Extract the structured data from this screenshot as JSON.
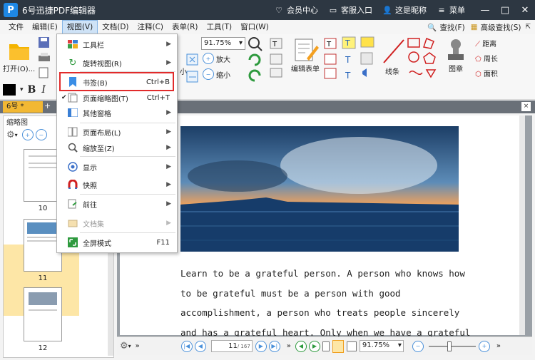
{
  "app": {
    "title": "6号迅捷PDF编辑器",
    "logo_letter": "P"
  },
  "titlebar": {
    "links": [
      {
        "icon": "heart-icon",
        "label": "会员中心"
      },
      {
        "icon": "chat-icon",
        "label": "客服入口"
      },
      {
        "icon": "user-icon",
        "label": "这是昵称"
      },
      {
        "icon": "hamburger-icon",
        "label": "菜单"
      }
    ],
    "win_min": "—",
    "win_max": "□",
    "win_close": "✕"
  },
  "menubar": {
    "items": [
      "文件",
      "编辑(E)",
      "视图(V)",
      "文档(D)",
      "注释(C)",
      "表单(R)",
      "工具(T)",
      "窗口(W)"
    ],
    "active_index": 2,
    "find_label": "查找(F)",
    "adv_find_label": "高级查找(S)"
  },
  "toolbar": {
    "open_label": "打开(O)...",
    "zoom_value": "91.75%",
    "zoom_in": "放大",
    "zoom_out": "缩小",
    "edit_form": "编辑表单",
    "lines": "线条",
    "stamp": "图章",
    "distance": "距离",
    "perimeter": "周长",
    "area": "面积",
    "bold": "B",
    "italic": "I",
    "small_label": "小"
  },
  "tabs": {
    "doc_tab": "6号 *",
    "plus": "+",
    "close": "×"
  },
  "sidebar": {
    "title": "缩略图",
    "thumbs": [
      {
        "num": "10"
      },
      {
        "num": "11"
      },
      {
        "num": "12"
      }
    ]
  },
  "dropdown": {
    "items": [
      {
        "icon": "toolbar-icon",
        "label": "工具栏",
        "shortcut": "",
        "submenu": true,
        "disabled": false,
        "check": false
      },
      {
        "icon": "rotate-icon",
        "label": "旋转视图(R)",
        "shortcut": "",
        "submenu": true,
        "disabled": false,
        "check": false
      },
      {
        "icon": "bookmark-icon",
        "label": "书签(B)",
        "shortcut": "Ctrl+B",
        "submenu": false,
        "disabled": false,
        "check": false
      },
      {
        "icon": "thumbnail-icon",
        "label": "页面缩略图(T)",
        "shortcut": "Ctrl+T",
        "submenu": false,
        "disabled": false,
        "check": true
      },
      {
        "icon": "grid-icon",
        "label": "其他窗格",
        "shortcut": "",
        "submenu": true,
        "disabled": false,
        "check": false
      },
      {
        "icon": "layout-icon",
        "label": "页面布局(L)",
        "shortcut": "",
        "submenu": true,
        "disabled": false,
        "check": false
      },
      {
        "icon": "magnifier-icon",
        "label": "缩放至(Z)",
        "shortcut": "",
        "submenu": true,
        "disabled": false,
        "check": false
      },
      {
        "icon": "eye-icon",
        "label": "显示",
        "shortcut": "",
        "submenu": true,
        "disabled": false,
        "check": false
      },
      {
        "icon": "magnet-icon",
        "label": "快照",
        "shortcut": "",
        "submenu": true,
        "disabled": false,
        "check": false
      },
      {
        "icon": "forward-icon",
        "label": "前往",
        "shortcut": "",
        "submenu": true,
        "disabled": false,
        "check": false
      },
      {
        "icon": "docset-icon",
        "label": "文档集",
        "shortcut": "",
        "submenu": true,
        "disabled": true,
        "check": false
      },
      {
        "icon": "fullscreen-icon",
        "label": "全屏模式",
        "shortcut": "F11",
        "submenu": false,
        "disabled": false,
        "check": false
      }
    ]
  },
  "document": {
    "lines": [
      "Learn to be a grateful person. A person who knows how",
      "to be grateful must be a person with good",
      "accomplishment, a person who treats people sincerely",
      "and has a grateful heart. Only when we have a grateful"
    ]
  },
  "status": {
    "current_page": "11",
    "total_pages": "/ 167",
    "zoom": "91.75%"
  }
}
